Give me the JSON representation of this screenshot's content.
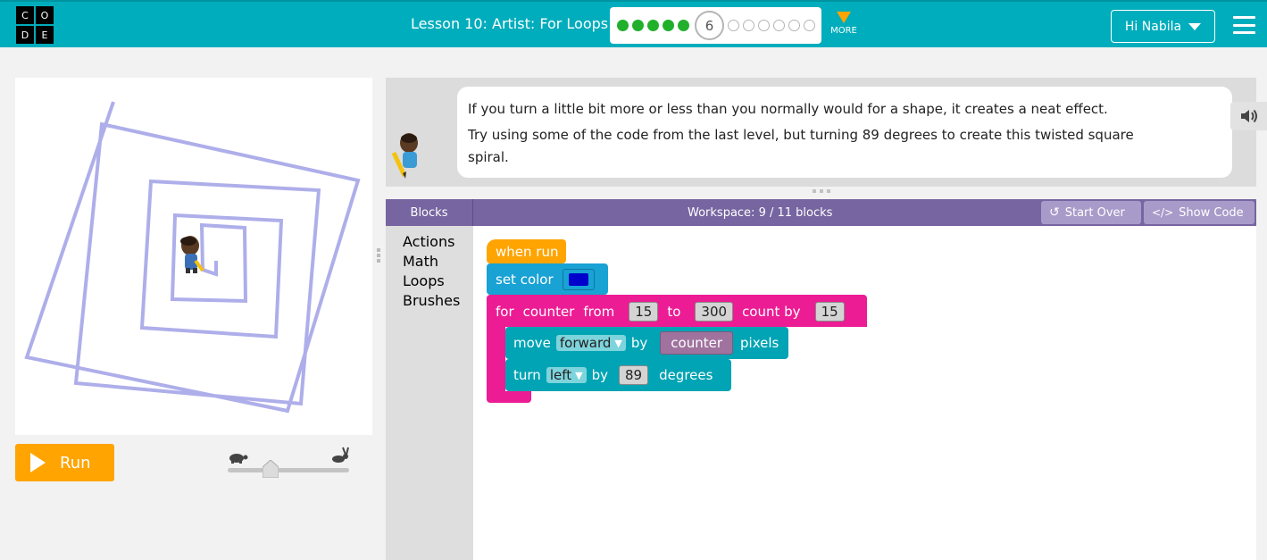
{
  "header": {
    "logo_letters": [
      "C",
      "O",
      "D",
      "E"
    ],
    "lesson_title": "Lesson 10: Artist: For Loops",
    "current_level": "6",
    "more_label": "MORE",
    "user_greeting": "Hi Nabila"
  },
  "colors": {
    "header_bg": "#00adbc",
    "run_button": "#ffa400",
    "workspace_header": "#7665a0",
    "when_run_block": "#ffa400",
    "set_color_block": "#19a2d4",
    "loop_block": "#ec1c94",
    "movement_block": "#00a4b4",
    "swatch_color": "#0000cc",
    "spiral_color": "#aeaeea"
  },
  "run_button": {
    "label": "Run"
  },
  "instructions": {
    "line1": "If you turn a little bit more or less than you normally would for a shape, it creates a neat effect.",
    "line2": "Try using some of the code from the last level, but turning 89 degrees to create this twisted square spiral."
  },
  "workspace": {
    "blocks_tab_label": "Blocks",
    "count_label": "Workspace: 9 / 11 blocks",
    "start_over_label": "Start Over",
    "show_code_label": "Show Code"
  },
  "toolbox": {
    "categories": [
      "Actions",
      "Math",
      "Loops",
      "Brushes"
    ]
  },
  "program": {
    "when_run_label": "when run",
    "set_color_label": "set color",
    "for_label": "for",
    "counter_var": "counter",
    "from_label": "from",
    "from_value": "15",
    "to_label": "to",
    "to_value": "300",
    "count_by_label": "count by",
    "count_by_value": "15",
    "move_label": "move",
    "move_direction": "forward",
    "by_label": "by",
    "move_by_var": "counter",
    "pixels_label": "pixels",
    "turn_label": "turn",
    "turn_direction": "left",
    "turn_by_label": "by",
    "turn_value": "89",
    "degrees_label": "degrees"
  }
}
